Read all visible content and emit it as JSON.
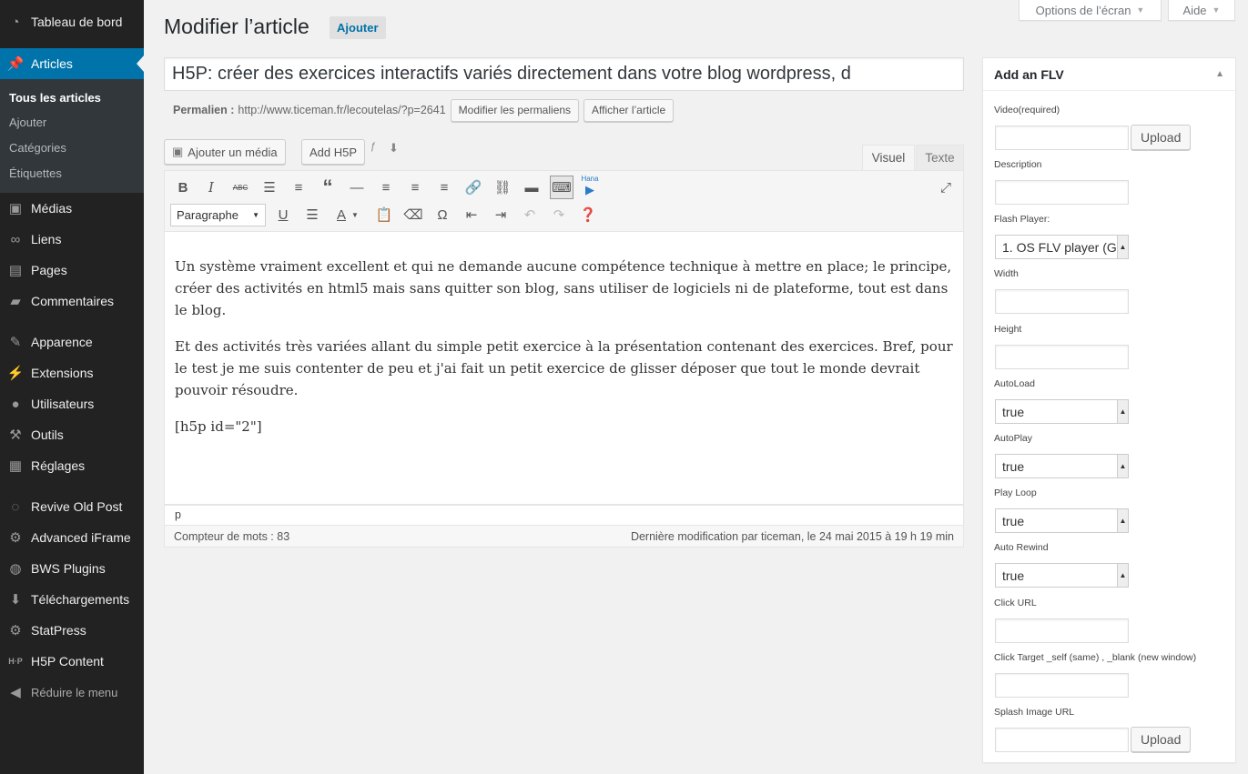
{
  "sidebar": {
    "items": [
      {
        "label": "Tableau de bord",
        "icon": "dashboard-icon"
      },
      {
        "label": "Articles",
        "icon": "pin-icon"
      },
      {
        "label": "Médias",
        "icon": "media-icon"
      },
      {
        "label": "Liens",
        "icon": "link-icon"
      },
      {
        "label": "Pages",
        "icon": "pages-icon"
      },
      {
        "label": "Commentaires",
        "icon": "comments-icon"
      },
      {
        "label": "Apparence",
        "icon": "appearance-icon"
      },
      {
        "label": "Extensions",
        "icon": "plugins-icon"
      },
      {
        "label": "Utilisateurs",
        "icon": "users-icon"
      },
      {
        "label": "Outils",
        "icon": "tools-icon"
      },
      {
        "label": "Réglages",
        "icon": "settings-icon"
      },
      {
        "label": "Revive Old Post",
        "icon": "revive-icon"
      },
      {
        "label": "Advanced iFrame",
        "icon": "gear-icon"
      },
      {
        "label": "BWS Plugins",
        "icon": "bws-icon"
      },
      {
        "label": "Téléchargements",
        "icon": "download-icon"
      },
      {
        "label": "StatPress",
        "icon": "gear-icon"
      },
      {
        "label": "H5P Content",
        "icon": "h5p-icon"
      }
    ],
    "submenu": [
      "Tous les articles",
      "Ajouter",
      "Catégories",
      "Étiquettes"
    ],
    "collapse_label": "Réduire le menu"
  },
  "header": {
    "screen_options": "Options de l’écran",
    "help": "Aide",
    "page_title": "Modifier l’article",
    "add_new": "Ajouter"
  },
  "post": {
    "title": "H5P: créer des exercices interactifs variés directement dans votre blog wordpress, d",
    "permalink_label": "Permalien :",
    "permalink_url": "http://www.ticeman.fr/lecoutelas/?p=2641",
    "edit_permalinks": "Modifier les permaliens",
    "view_post": "Afficher l’article"
  },
  "editor": {
    "add_media": "Ajouter un média",
    "add_h5p": "Add H5P",
    "tab_visual": "Visuel",
    "tab_text": "Texte",
    "format_select": "Paragraphe",
    "hana_label": "Hana",
    "paragraphs": [
      "Un système vraiment excellent et qui ne demande aucune compétence technique à mettre en place; le principe, créer des activités en html5 mais sans quitter son blog, sans utiliser de logiciels ni de plateforme, tout est dans le blog.",
      "Et des activités très variées allant du simple petit exercice à la présentation contenant des exercices. Bref, pour le test je me suis contenter de peu et j'ai fait un petit exercice de glisser déposer que tout le monde devrait pouvoir résoudre.",
      "[h5p id=\"2\"]"
    ],
    "path": "p",
    "word_count": "Compteur de mots : 83",
    "last_modified": "Dernière modification par ticeman, le 24 mai 2015 à 19 h 19 min"
  },
  "flv": {
    "title": "Add an FLV",
    "video_label": "Video(required)",
    "upload_label": "Upload",
    "description_label": "Description",
    "flash_player_label": "Flash Player:",
    "flash_player_value": "1. OS FLV player (G",
    "width_label": "Width",
    "height_label": "Height",
    "autoload_label": "AutoLoad",
    "autoload_value": "true",
    "autoplay_label": "AutoPlay",
    "autoplay_value": "true",
    "playloop_label": "Play Loop",
    "playloop_value": "true",
    "autorewind_label": "Auto Rewind",
    "autorewind_value": "true",
    "click_url_label": "Click URL",
    "click_target_label": "Click Target _self (same) , _blank (new window)",
    "splash_label": "Splash Image URL",
    "splash_upload_label": "Upload"
  },
  "colors": {
    "accent": "#0073aa",
    "sidebar": "#222222",
    "submenu": "#32373c",
    "background": "#f1f1f1"
  }
}
